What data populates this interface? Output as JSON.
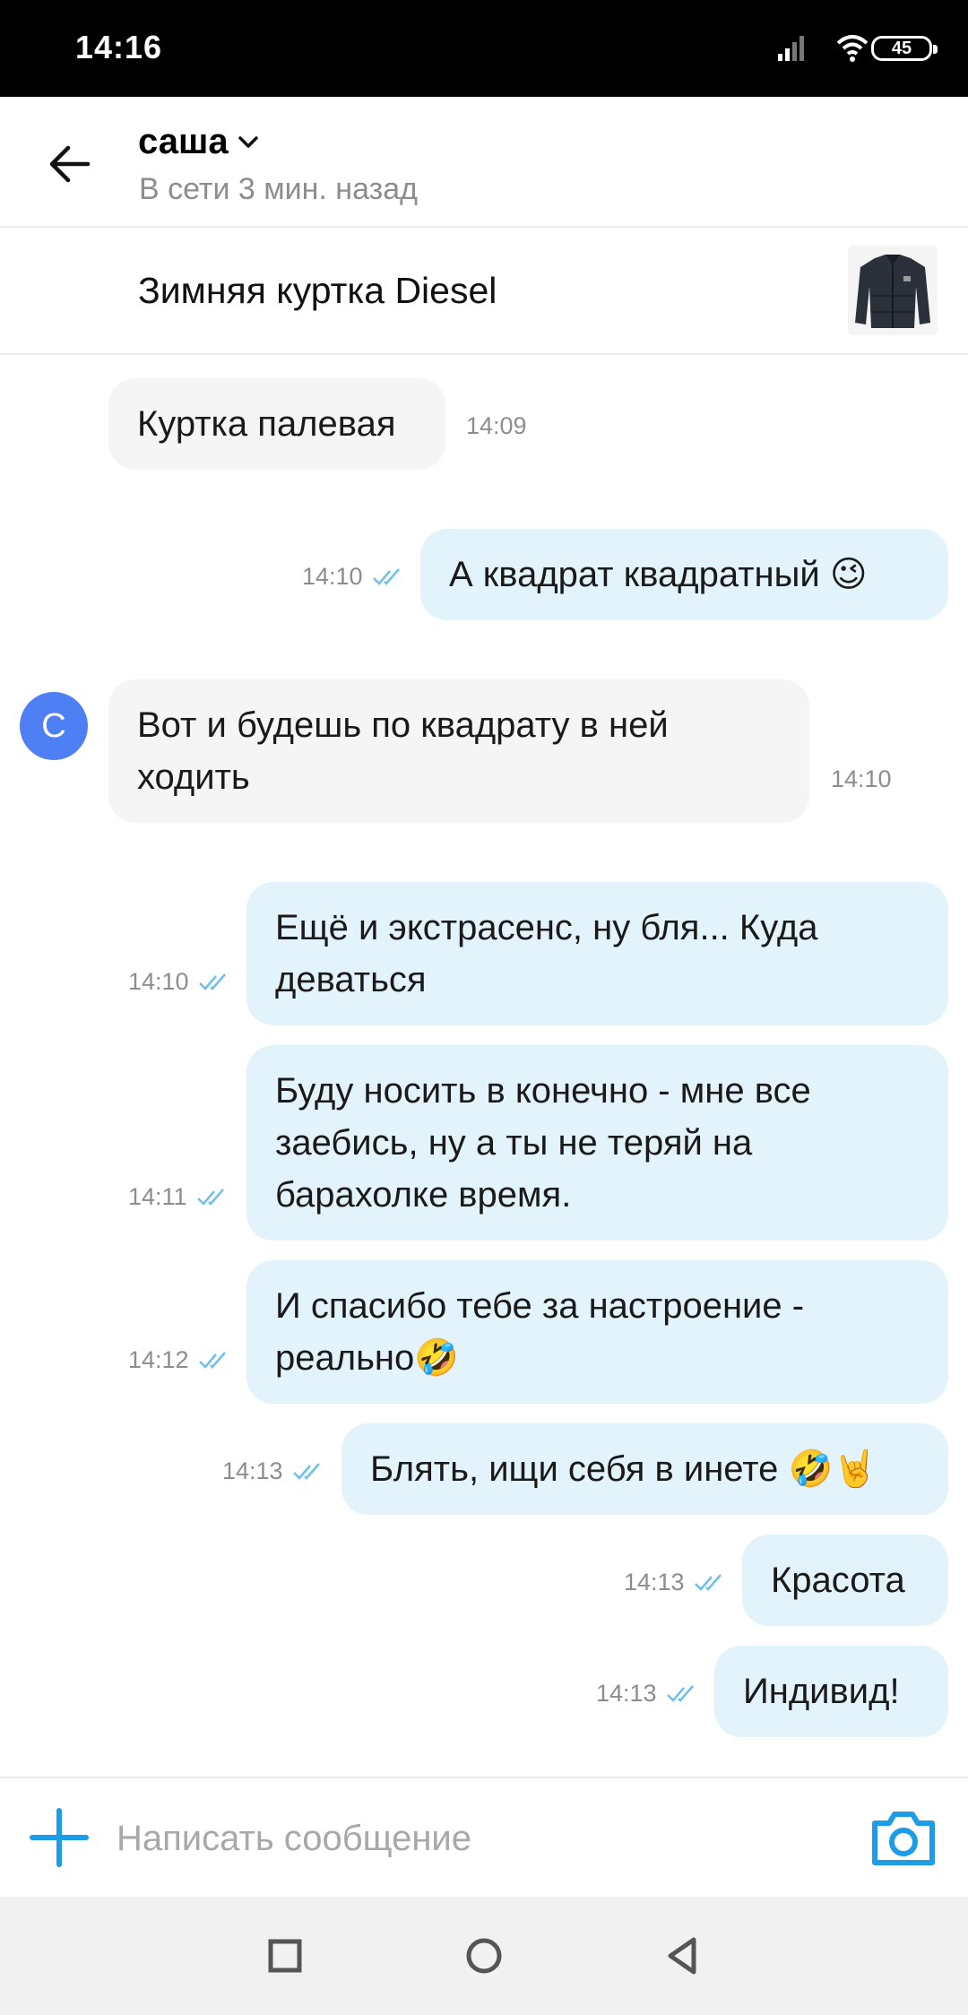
{
  "status_bar": {
    "time": "14:16",
    "battery": "45",
    "icons": [
      "signal-icon",
      "wifi-icon",
      "battery-icon"
    ]
  },
  "header": {
    "contact_name": "саша",
    "contact_status": "В сети 3 мин. назад"
  },
  "listing": {
    "title": "Зимняя куртка Diesel"
  },
  "avatar_letter": "С",
  "messages": [
    {
      "dir": "in",
      "lines": [
        "Куртка палевая"
      ],
      "time": "14:09"
    },
    {
      "dir": "out",
      "lines": [
        "А квадрат квадратный 😉"
      ],
      "time": "14:10",
      "read": true
    },
    {
      "dir": "in",
      "lines": [
        "Вот и будешь по квадрату в ней",
        "ходить"
      ],
      "time": "14:10"
    },
    {
      "dir": "out",
      "lines": [
        "Ещё и экстрасенс, ну бля... Куда",
        "деваться"
      ],
      "time": "14:10",
      "read": true
    },
    {
      "dir": "out",
      "lines": [
        "Буду носить в конечно - мне все",
        "заебись, ну а ты не теряй на",
        "барахолке время."
      ],
      "time": "14:11",
      "read": true
    },
    {
      "dir": "out",
      "lines": [
        "И спасибо тебе за настроение -",
        "реально🤣"
      ],
      "time": "14:12",
      "read": true
    },
    {
      "dir": "out",
      "lines": [
        "Блять, ищи себя в инете 🤣🤘"
      ],
      "time": "14:13",
      "read": true
    },
    {
      "dir": "out",
      "lines": [
        "Красота"
      ],
      "time": "14:13",
      "read": true
    },
    {
      "dir": "out",
      "lines": [
        "Индивид!"
      ],
      "time": "14:13",
      "read": true
    }
  ],
  "composer": {
    "placeholder": "Написать сообщение"
  },
  "colors": {
    "accent": "#1d9de6",
    "outgoing_bubble": "#e3f3fc",
    "incoming_bubble": "#f5f5f5",
    "avatar": "#4f7ff5"
  }
}
